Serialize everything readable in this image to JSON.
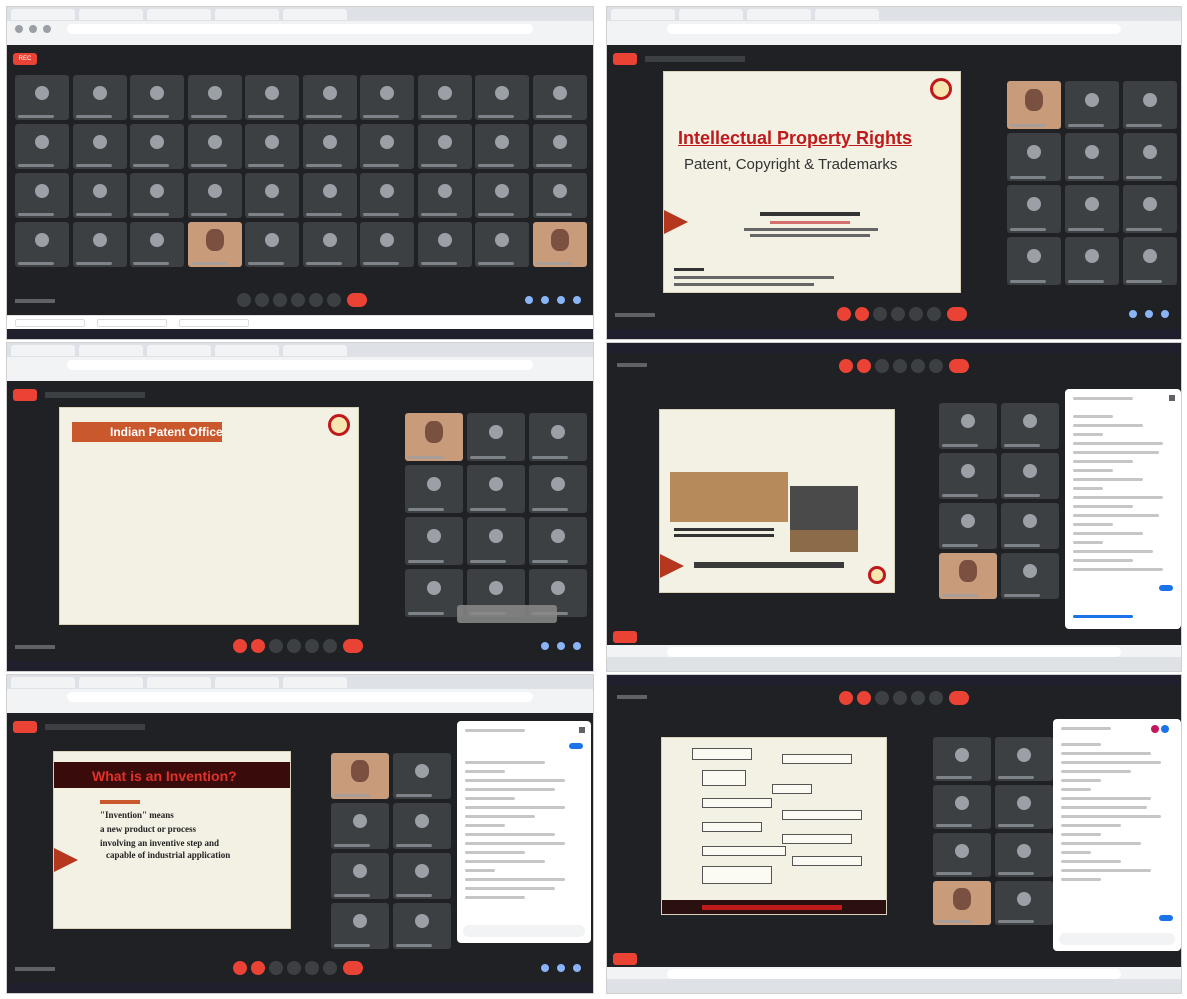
{
  "panels": {
    "p1": {
      "recording_label": "REC",
      "controls": [
        "mic",
        "camera",
        "captions",
        "raise-hand",
        "present",
        "more",
        "end-call"
      ]
    },
    "p2": {
      "slide": {
        "title": "Intellectual Property Rights",
        "subtitle": "Patent, Copyright & Trademarks"
      }
    },
    "p3": {
      "slide": {
        "title": "Indian Patent Office"
      }
    },
    "p5": {
      "slide": {
        "title": "What is an Invention?",
        "line1": "\"Invention\" means",
        "line2": "a new product or process",
        "line3": "involving an inventive step and",
        "line4": "capable of industrial application"
      }
    }
  },
  "colors": {
    "meet_bg": "#202124",
    "tile_bg": "#3c4043",
    "accent_red": "#ea4335",
    "slide_title_red": "#c0191c",
    "chevron": "#b5381e"
  }
}
